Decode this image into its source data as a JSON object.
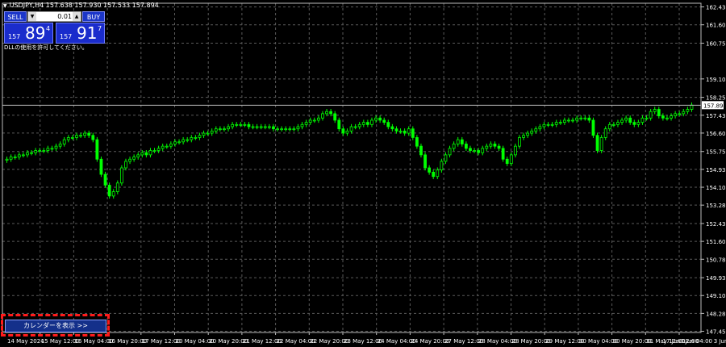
{
  "header": {
    "symbol_info": "USDJPY,H4  157.638 157.930 157.533 157.894"
  },
  "trade_panel": {
    "sell_label": "SELL",
    "buy_label": "BUY",
    "lot_value": "0.01",
    "sell_price": {
      "prefix": "157",
      "big": "89",
      "sup": "4"
    },
    "buy_price": {
      "prefix": "157",
      "big": "91",
      "sup": "7"
    },
    "notice": "DLLの使用を許可してください。"
  },
  "calendar_button": {
    "label": "カレンダーを表示  >>"
  },
  "colors": {
    "background": "#000000",
    "grid": "#5a5a5a",
    "candle": "#00ff00",
    "price_line": "#c0c0c0"
  },
  "chart_data": {
    "type": "candlestick",
    "symbol": "USDJPY",
    "timeframe": "H4",
    "current_price": "157.894",
    "ylim": [
      147.4,
      162.6
    ],
    "y_ticks": [
      "162.430",
      "161.605",
      "160.755",
      "159.105",
      "158.255",
      "157.430",
      "156.605",
      "155.755",
      "154.930",
      "154.105",
      "153.280",
      "152.430",
      "151.605",
      "150.780",
      "149.930",
      "149.105",
      "148.280",
      "147.455"
    ],
    "x_ticks": [
      "14 May 2024",
      "15 May 12:00",
      "16 May 04:00",
      "16 May 20:00",
      "17 May 12:00",
      "20 May 04:00",
      "20 May 20:00",
      "21 May 12:00",
      "22 May 04:00",
      "22 May 20:00",
      "23 May 12:00",
      "24 May 04:00",
      "24 May 20:00",
      "27 May 12:00",
      "28 May 04:00",
      "28 May 20:00",
      "29 May 12:00",
      "30 May 04:00",
      "30 May 20:00",
      "31 May 12:00",
      "3 Jun 04:00",
      "3 Jun 20:00",
      "4 Jun 12:00",
      "5 Jun 04:00",
      "5 Jun 20:00",
      "6 Jun 12:00",
      "7 Jun 04:00",
      "7 Jun 20:00",
      "10 Jun 12:00",
      "11 Jun 04:00",
      "11 Jun 20:00",
      "12 Jun 12:00",
      "13 Jun 04:00",
      "13 Jun 20:00",
      "14 Jun 12:00",
      "17 Jun 04:00",
      "17 Jun 12:00"
    ],
    "close_series": [
      155.4,
      155.5,
      155.5,
      155.6,
      155.6,
      155.7,
      155.7,
      155.8,
      155.8,
      155.8,
      155.9,
      155.9,
      156.0,
      156.1,
      156.3,
      156.4,
      156.4,
      156.5,
      156.5,
      156.6,
      156.5,
      156.3,
      155.4,
      154.7,
      154.2,
      153.7,
      153.9,
      154.3,
      155.0,
      155.3,
      155.4,
      155.5,
      155.6,
      155.7,
      155.6,
      155.8,
      155.8,
      155.9,
      156.0,
      156.0,
      156.1,
      156.2,
      156.2,
      156.3,
      156.3,
      156.4,
      156.4,
      156.5,
      156.6,
      156.6,
      156.7,
      156.8,
      156.8,
      156.8,
      156.9,
      157.0,
      157.0,
      157.0,
      157.0,
      156.9,
      156.9,
      156.9,
      156.9,
      156.9,
      156.9,
      156.8,
      156.8,
      156.8,
      156.8,
      156.8,
      156.8,
      156.9,
      157.0,
      157.1,
      157.2,
      157.2,
      157.3,
      157.5,
      157.6,
      157.5,
      157.2,
      156.8,
      156.6,
      156.7,
      156.9,
      156.9,
      157.0,
      157.1,
      157.0,
      157.2,
      157.3,
      157.2,
      157.1,
      156.9,
      156.8,
      156.7,
      156.7,
      156.6,
      156.8,
      156.4,
      156.0,
      155.6,
      155.0,
      154.8,
      154.6,
      154.9,
      155.3,
      155.6,
      155.9,
      156.1,
      156.3,
      156.1,
      155.9,
      155.8,
      155.8,
      155.7,
      155.9,
      156.0,
      156.1,
      156.0,
      155.9,
      155.4,
      155.2,
      155.6,
      156.0,
      156.4,
      156.5,
      156.6,
      156.7,
      156.8,
      156.9,
      157.0,
      157.0,
      157.0,
      157.1,
      157.1,
      157.2,
      157.2,
      157.2,
      157.3,
      157.3,
      157.3,
      157.2,
      156.5,
      155.8,
      156.4,
      156.8,
      157.0,
      157.0,
      157.1,
      157.2,
      157.3,
      157.1,
      157.0,
      157.1,
      157.3,
      157.3,
      157.6,
      157.7,
      157.4,
      157.3,
      157.3,
      157.4,
      157.5,
      157.5,
      157.6,
      157.7,
      157.9
    ]
  }
}
